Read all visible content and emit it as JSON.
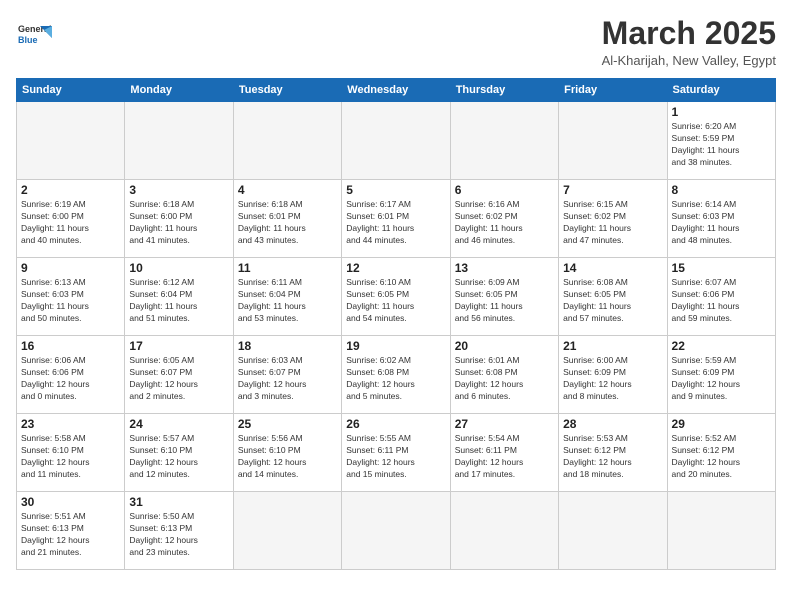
{
  "logo": {
    "text_general": "General",
    "text_blue": "Blue"
  },
  "header": {
    "month_title": "March 2025",
    "subtitle": "Al-Kharijah, New Valley, Egypt"
  },
  "weekdays": [
    "Sunday",
    "Monday",
    "Tuesday",
    "Wednesday",
    "Thursday",
    "Friday",
    "Saturday"
  ],
  "weeks": [
    [
      {
        "day": "",
        "info": ""
      },
      {
        "day": "",
        "info": ""
      },
      {
        "day": "",
        "info": ""
      },
      {
        "day": "",
        "info": ""
      },
      {
        "day": "",
        "info": ""
      },
      {
        "day": "",
        "info": ""
      },
      {
        "day": "1",
        "info": "Sunrise: 6:20 AM\nSunset: 5:59 PM\nDaylight: 11 hours\nand 38 minutes."
      }
    ],
    [
      {
        "day": "2",
        "info": "Sunrise: 6:19 AM\nSunset: 6:00 PM\nDaylight: 11 hours\nand 40 minutes."
      },
      {
        "day": "3",
        "info": "Sunrise: 6:18 AM\nSunset: 6:00 PM\nDaylight: 11 hours\nand 41 minutes."
      },
      {
        "day": "4",
        "info": "Sunrise: 6:18 AM\nSunset: 6:01 PM\nDaylight: 11 hours\nand 43 minutes."
      },
      {
        "day": "5",
        "info": "Sunrise: 6:17 AM\nSunset: 6:01 PM\nDaylight: 11 hours\nand 44 minutes."
      },
      {
        "day": "6",
        "info": "Sunrise: 6:16 AM\nSunset: 6:02 PM\nDaylight: 11 hours\nand 46 minutes."
      },
      {
        "day": "7",
        "info": "Sunrise: 6:15 AM\nSunset: 6:02 PM\nDaylight: 11 hours\nand 47 minutes."
      },
      {
        "day": "8",
        "info": "Sunrise: 6:14 AM\nSunset: 6:03 PM\nDaylight: 11 hours\nand 48 minutes."
      }
    ],
    [
      {
        "day": "9",
        "info": "Sunrise: 6:13 AM\nSunset: 6:03 PM\nDaylight: 11 hours\nand 50 minutes."
      },
      {
        "day": "10",
        "info": "Sunrise: 6:12 AM\nSunset: 6:04 PM\nDaylight: 11 hours\nand 51 minutes."
      },
      {
        "day": "11",
        "info": "Sunrise: 6:11 AM\nSunset: 6:04 PM\nDaylight: 11 hours\nand 53 minutes."
      },
      {
        "day": "12",
        "info": "Sunrise: 6:10 AM\nSunset: 6:05 PM\nDaylight: 11 hours\nand 54 minutes."
      },
      {
        "day": "13",
        "info": "Sunrise: 6:09 AM\nSunset: 6:05 PM\nDaylight: 11 hours\nand 56 minutes."
      },
      {
        "day": "14",
        "info": "Sunrise: 6:08 AM\nSunset: 6:05 PM\nDaylight: 11 hours\nand 57 minutes."
      },
      {
        "day": "15",
        "info": "Sunrise: 6:07 AM\nSunset: 6:06 PM\nDaylight: 11 hours\nand 59 minutes."
      }
    ],
    [
      {
        "day": "16",
        "info": "Sunrise: 6:06 AM\nSunset: 6:06 PM\nDaylight: 12 hours\nand 0 minutes."
      },
      {
        "day": "17",
        "info": "Sunrise: 6:05 AM\nSunset: 6:07 PM\nDaylight: 12 hours\nand 2 minutes."
      },
      {
        "day": "18",
        "info": "Sunrise: 6:03 AM\nSunset: 6:07 PM\nDaylight: 12 hours\nand 3 minutes."
      },
      {
        "day": "19",
        "info": "Sunrise: 6:02 AM\nSunset: 6:08 PM\nDaylight: 12 hours\nand 5 minutes."
      },
      {
        "day": "20",
        "info": "Sunrise: 6:01 AM\nSunset: 6:08 PM\nDaylight: 12 hours\nand 6 minutes."
      },
      {
        "day": "21",
        "info": "Sunrise: 6:00 AM\nSunset: 6:09 PM\nDaylight: 12 hours\nand 8 minutes."
      },
      {
        "day": "22",
        "info": "Sunrise: 5:59 AM\nSunset: 6:09 PM\nDaylight: 12 hours\nand 9 minutes."
      }
    ],
    [
      {
        "day": "23",
        "info": "Sunrise: 5:58 AM\nSunset: 6:10 PM\nDaylight: 12 hours\nand 11 minutes."
      },
      {
        "day": "24",
        "info": "Sunrise: 5:57 AM\nSunset: 6:10 PM\nDaylight: 12 hours\nand 12 minutes."
      },
      {
        "day": "25",
        "info": "Sunrise: 5:56 AM\nSunset: 6:10 PM\nDaylight: 12 hours\nand 14 minutes."
      },
      {
        "day": "26",
        "info": "Sunrise: 5:55 AM\nSunset: 6:11 PM\nDaylight: 12 hours\nand 15 minutes."
      },
      {
        "day": "27",
        "info": "Sunrise: 5:54 AM\nSunset: 6:11 PM\nDaylight: 12 hours\nand 17 minutes."
      },
      {
        "day": "28",
        "info": "Sunrise: 5:53 AM\nSunset: 6:12 PM\nDaylight: 12 hours\nand 18 minutes."
      },
      {
        "day": "29",
        "info": "Sunrise: 5:52 AM\nSunset: 6:12 PM\nDaylight: 12 hours\nand 20 minutes."
      }
    ],
    [
      {
        "day": "30",
        "info": "Sunrise: 5:51 AM\nSunset: 6:13 PM\nDaylight: 12 hours\nand 21 minutes."
      },
      {
        "day": "31",
        "info": "Sunrise: 5:50 AM\nSunset: 6:13 PM\nDaylight: 12 hours\nand 23 minutes."
      },
      {
        "day": "",
        "info": ""
      },
      {
        "day": "",
        "info": ""
      },
      {
        "day": "",
        "info": ""
      },
      {
        "day": "",
        "info": ""
      },
      {
        "day": "",
        "info": ""
      }
    ]
  ]
}
